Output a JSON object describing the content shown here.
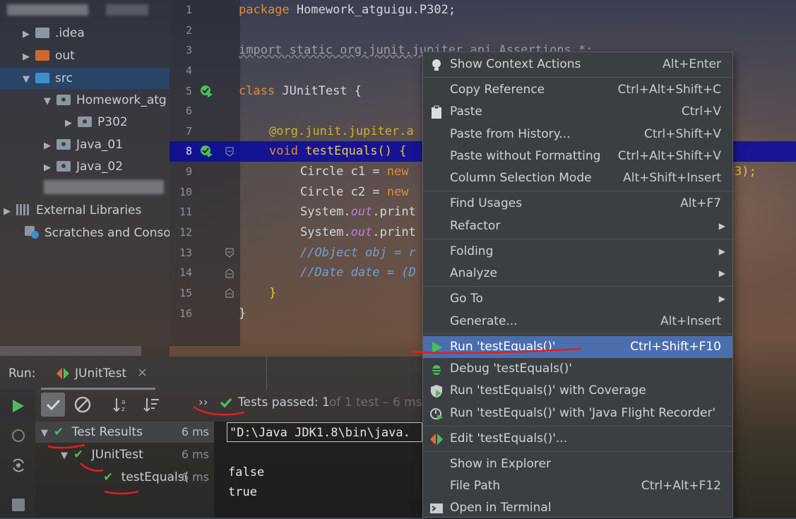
{
  "project_tree": {
    "items": [
      {
        "label": ".idea"
      },
      {
        "label": "out"
      },
      {
        "label": "src"
      },
      {
        "label": "Homework_atg"
      },
      {
        "label": "P302"
      },
      {
        "label": "Java_01"
      },
      {
        "label": "Java_02"
      },
      {
        "label": "External Libraries"
      },
      {
        "label": "Scratches and Consoles"
      }
    ]
  },
  "editor": {
    "line_numbers": [
      "1",
      "2",
      "3",
      "4",
      "5",
      "6",
      "7",
      "8",
      "9",
      "10",
      "11",
      "12",
      "13",
      "14",
      "15",
      "16"
    ],
    "lines": {
      "l1_kw": "package",
      "l1_rest": " Homework_atguigu.P302;",
      "l3": "import static org.junit.jupiter.api.Assertions.*;",
      "l5_kw": "class",
      "l5_rest": " JUnitTest {",
      "l7": "@org.junit.jupiter.a",
      "l8_kw": "void",
      "l8_fn": " testEquals",
      "l8_rest": "() {",
      "l9_a": "Circle c1 = ",
      "l9_kw": "new",
      "l9_tail": "3);",
      "l10_a": "Circle c2 = ",
      "l10_kw": "new",
      "l11_a": "System.",
      "l11_out": "out",
      "l11_b": ".print",
      "l12_a": "System.",
      "l12_out": "out",
      "l12_b": ".print",
      "l13": "//Object obj = r",
      "l14": "//Date date = (D",
      "l15": "}",
      "l16": "}"
    }
  },
  "context_menu": {
    "items": [
      {
        "label": "Show Context Actions",
        "shortcut": "Alt+Enter"
      },
      {
        "label": "Copy Reference",
        "shortcut": "Ctrl+Alt+Shift+C"
      },
      {
        "label": "Paste",
        "shortcut": "Ctrl+V"
      },
      {
        "label": "Paste from History...",
        "shortcut": "Ctrl+Shift+V"
      },
      {
        "label": "Paste without Formatting",
        "shortcut": "Ctrl+Alt+Shift+V"
      },
      {
        "label": "Column Selection Mode",
        "shortcut": "Alt+Shift+Insert"
      },
      {
        "label": "Find Usages",
        "shortcut": "Alt+F7"
      },
      {
        "label": "Refactor",
        "shortcut": ""
      },
      {
        "label": "Folding",
        "shortcut": ""
      },
      {
        "label": "Analyze",
        "shortcut": ""
      },
      {
        "label": "Go To",
        "shortcut": ""
      },
      {
        "label": "Generate...",
        "shortcut": "Alt+Insert"
      },
      {
        "label": "Run 'testEquals()'",
        "shortcut": "Ctrl+Shift+F10"
      },
      {
        "label": "Debug 'testEquals()'",
        "shortcut": ""
      },
      {
        "label": "Run 'testEquals()' with Coverage",
        "shortcut": ""
      },
      {
        "label": "Run 'testEquals()' with 'Java Flight Recorder'",
        "shortcut": ""
      },
      {
        "label": "Edit 'testEquals()'...",
        "shortcut": ""
      },
      {
        "label": "Show in Explorer",
        "shortcut": ""
      },
      {
        "label": "File Path",
        "shortcut": "Ctrl+Alt+F12"
      },
      {
        "label": "Open in Terminal",
        "shortcut": ""
      }
    ],
    "submenu_arrow": "▶"
  },
  "run_panel": {
    "run_label": "Run:",
    "tab_label": "JUnitTest",
    "close_glyph": "×",
    "status_arrow": "››",
    "status_text": "Tests passed: 1",
    "status_detail": "of 1 test – 6 ms",
    "results": [
      {
        "label": "Test Results",
        "time": "6 ms"
      },
      {
        "label": "JUnitTest",
        "time": "6 ms"
      },
      {
        "label": "testEquals(",
        "time": "6 ms"
      }
    ],
    "console": {
      "command": "\"D:\\Java JDK1.8\\bin\\java.",
      "output": [
        "false",
        "true"
      ]
    }
  },
  "colors": {
    "menu_bg": "#3c3f41",
    "menu_selected": "#4b6eaf",
    "current_line": "#0a0aa0",
    "success_green": "#4dbd5a",
    "annotation_red": "#e0201c"
  }
}
